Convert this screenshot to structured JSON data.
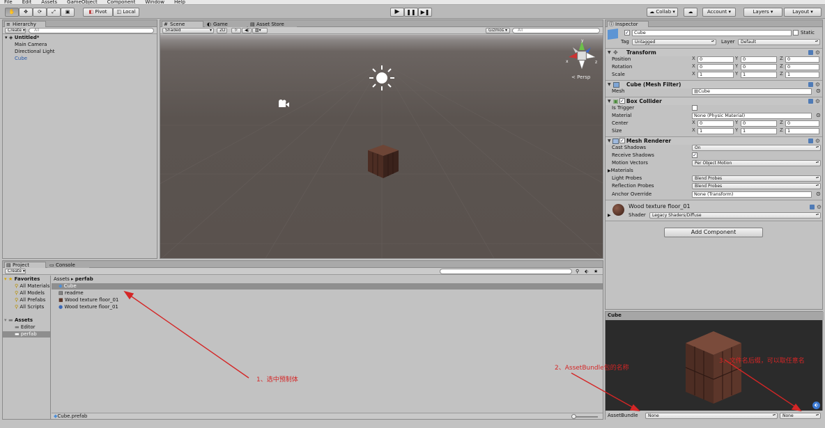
{
  "menubar": [
    "File",
    "Edit",
    "Assets",
    "GameObject",
    "Component",
    "Window",
    "Help"
  ],
  "toolbar": {
    "pivot_label": "Pivot",
    "local_label": "Local",
    "collab_label": "Collab",
    "account_label": "Account",
    "layers_label": "Layers",
    "layout_label": "Layout"
  },
  "hierarchy": {
    "tab": "Hierarchy",
    "create_label": "Create",
    "search_placeholder": "All",
    "scene_name": "Untitled*",
    "items": [
      "Main Camera",
      "Directional Light",
      "Cube"
    ]
  },
  "scene": {
    "tabs": [
      "Scene",
      "Game",
      "Asset Store"
    ],
    "shading_mode": "Shaded",
    "mode_2d": "2D",
    "gizmos_label": "Gizmos",
    "search_placeholder": "All",
    "persp_label": "Persp",
    "axis_labels": {
      "y": "y",
      "x": "x",
      "z": "z"
    }
  },
  "project": {
    "tabs": [
      "Project",
      "Console"
    ],
    "create_label": "Create",
    "favorites_label": "Favorites",
    "favorites": [
      "All Materials",
      "All Models",
      "All Prefabs",
      "All Scripts"
    ],
    "assets_label": "Assets",
    "asset_folders": [
      "Editor",
      "perfab"
    ],
    "breadcrumb": [
      "Assets",
      "perfab"
    ],
    "files": [
      "Cube",
      "readme",
      "Wood texture floor_01",
      "Wood texture floor_01"
    ],
    "status_file": "Cube.prefab"
  },
  "inspector": {
    "tab": "Inspector",
    "object_name": "Cube",
    "static_label": "Static",
    "tag_label": "Tag",
    "tag_value": "Untagged",
    "layer_label": "Layer",
    "layer_value": "Default",
    "transform": {
      "title": "Transform",
      "position_label": "Position",
      "rotation_label": "Rotation",
      "scale_label": "Scale",
      "position": [
        "0",
        "0",
        "0"
      ],
      "rotation": [
        "0",
        "0",
        "0"
      ],
      "scale": [
        "1",
        "1",
        "1"
      ]
    },
    "mesh_filter": {
      "title": "Cube (Mesh Filter)",
      "mesh_label": "Mesh",
      "mesh_value": "Cube"
    },
    "box_collider": {
      "title": "Box Collider",
      "is_trigger_label": "Is Trigger",
      "material_label": "Material",
      "material_value": "None (Physic Material)",
      "center_label": "Center",
      "size_label": "Size",
      "center": [
        "0",
        "0",
        "0"
      ],
      "size": [
        "1",
        "1",
        "1"
      ]
    },
    "mesh_renderer": {
      "title": "Mesh Renderer",
      "cast_shadows_label": "Cast Shadows",
      "cast_shadows_value": "On",
      "receive_shadows_label": "Receive Shadows",
      "motion_vectors_label": "Motion Vectors",
      "motion_vectors_value": "Per Object Motion",
      "materials_label": "Materials",
      "light_probes_label": "Light Probes",
      "light_probes_value": "Blend Probes",
      "reflection_probes_label": "Reflection Probes",
      "reflection_probes_value": "Blend Probes",
      "anchor_override_label": "Anchor Override",
      "anchor_override_value": "None (Transform)"
    },
    "material": {
      "name": "Wood texture floor_01",
      "shader_label": "Shader",
      "shader_value": "Legacy Shaders/Diffuse"
    },
    "add_component_label": "Add Component"
  },
  "preview": {
    "title": "Cube",
    "assetbundle_label": "AssetBundle",
    "bundle_name_value": "None",
    "bundle_variant_value": "None"
  },
  "annotations": {
    "a1": "1、选中预制体",
    "a2": "2、AssetBundle包的名称",
    "a3": "3、文件名后缀，可以取任意名"
  },
  "colors": {
    "annotation": "#d42626",
    "selection": "#3d6fb8",
    "scene_ground": "#5b5450",
    "scene_sky": "#a8a6a6"
  }
}
